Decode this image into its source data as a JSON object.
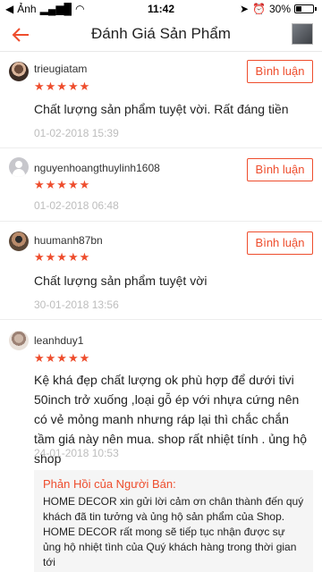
{
  "status_bar": {
    "carrier": "Ảnh",
    "time": "11:42",
    "battery": "30%"
  },
  "header": {
    "title": "Đánh Giá Sản Phẩm"
  },
  "reviews": [
    {
      "username": "trieugiatam",
      "stars": "★★★★★",
      "reply_label": "Bình luận",
      "comment": "Chất lượng sản phẩm tuyệt vời. Rất đáng tiền",
      "date": "01-02-2018 15:39"
    },
    {
      "username": "nguyenhoangthuylinh1608",
      "stars": "★★★★★",
      "reply_label": "Bình luận",
      "comment": "",
      "date": "01-02-2018 06:48"
    },
    {
      "username": "huumanh87bn",
      "stars": "★★★★★",
      "reply_label": "Bình luận",
      "comment": "Chất lượng sản phẩm tuyệt vời",
      "date": "30-01-2018 13:56"
    },
    {
      "username": "leanhduy1",
      "stars": "★★★★★",
      "comment": "Kệ khá đẹp chất lượng ok phù hợp để dưới tivi 50inch trở xuống ,loại gỗ ép với nhựa cứng nên có vẻ mỏng manh nhưng ráp lại thì chắc chắn tầm giá này nên mua. shop rất nhiệt tính . ủng hộ shop",
      "date": "24-01-2018 10:53",
      "seller_reply": {
        "title": "Phản Hồi của Người Bán:",
        "text": "HOME DECOR xin gửi lời cảm ơn chân thành đến quý khách đã tin tưởng và ủng hộ sản phẩm của Shop. HOME DECOR rất mong sẽ tiếp tục nhận được sự ủng hộ nhiệt tình của Quý khách hàng trong thời gian tới",
        "emoji": "❤️"
      }
    }
  ],
  "colors": {
    "accent": "#ee4d2d",
    "date_gray": "#bdbdbd"
  }
}
